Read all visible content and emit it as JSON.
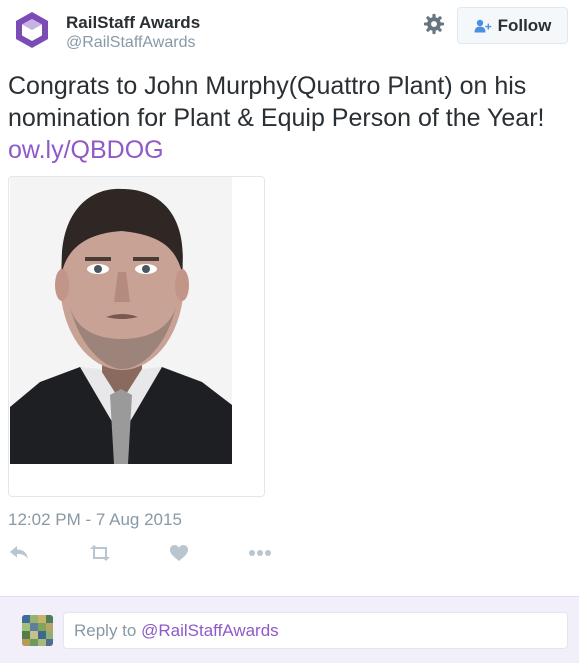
{
  "account": {
    "display_name": "RailStaff Awards",
    "handle": "@RailStaffAwards"
  },
  "header": {
    "follow_label": "Follow"
  },
  "tweet": {
    "text": "Congrats to John Murphy(Quattro Plant) on his nomination for Plant & Equip Person of the Year!",
    "link": "ow.ly/QBDOG",
    "timestamp": "12:02 PM - 7 Aug 2015"
  },
  "reply": {
    "prefix": "Reply to ",
    "handle": "@RailStaffAwards"
  },
  "icons": {
    "logo": "hexagon-logo-icon",
    "settings": "gear-icon",
    "follow": "add-user-icon",
    "reply": "reply-icon",
    "retweet": "retweet-icon",
    "like": "heart-icon",
    "more": "more-icon"
  },
  "colors": {
    "link": "#8f5ac8",
    "logo_purple": "#7b4bb6",
    "reply_bar": "#f3effa",
    "muted": "#8899a6",
    "action_icon": "#b9c5cf"
  }
}
